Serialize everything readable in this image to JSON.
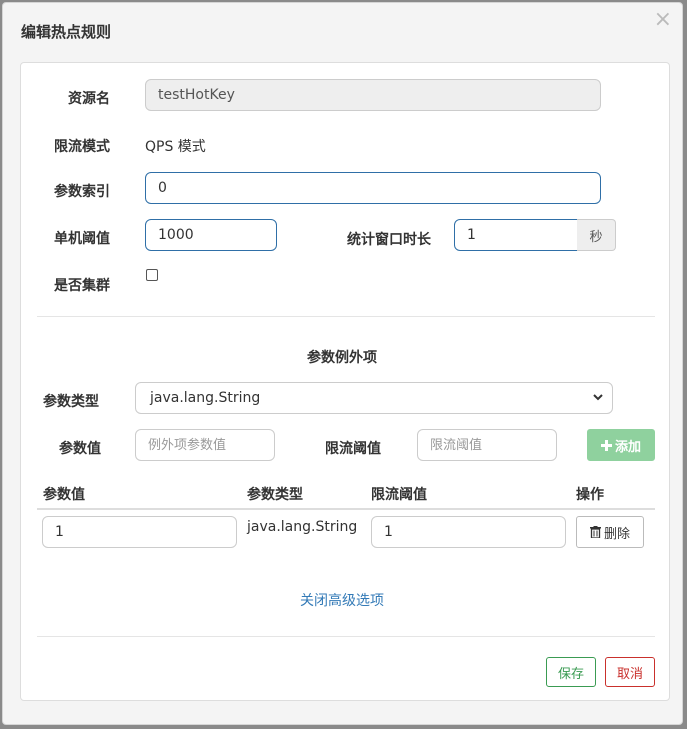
{
  "modal": {
    "title": "编辑热点规则",
    "close_glyph": "×"
  },
  "form": {
    "resource_label": "资源名",
    "resource_value": "testHotKey",
    "mode_label": "限流模式",
    "mode_value": "QPS 模式",
    "param_index_label": "参数索引",
    "param_index_value": "0",
    "threshold_label": "单机阈值",
    "threshold_value": "1000",
    "window_label": "统计窗口时长",
    "window_value": "1",
    "window_unit": "秒",
    "cluster_label": "是否集群",
    "cluster_checked": false
  },
  "exceptions": {
    "section_title": "参数例外项",
    "type_label": "参数类型",
    "type_selected": "java.lang.String",
    "value_label": "参数值",
    "value_placeholder": "例外项参数值",
    "limit_label": "限流阈值",
    "limit_placeholder": "限流阈值",
    "add_button": "添加",
    "add_icon": "plus-icon",
    "table": {
      "headers": [
        "参数值",
        "参数类型",
        "限流阈值",
        "操作"
      ],
      "rows": [
        {
          "param_value": "1",
          "param_type": "java.lang.String",
          "limit": "1",
          "action": "删除",
          "action_icon": "trash-icon"
        }
      ]
    },
    "toggle_link": "关闭高级选项"
  },
  "footer": {
    "save_label": "保存",
    "cancel_label": "取消"
  },
  "colors": {
    "primary_border": "#2f6fa7",
    "add_button_bg": "#8fd19e",
    "save_green": "#3a9b52",
    "cancel_red": "#c9302c",
    "link_blue": "#337ab7"
  }
}
